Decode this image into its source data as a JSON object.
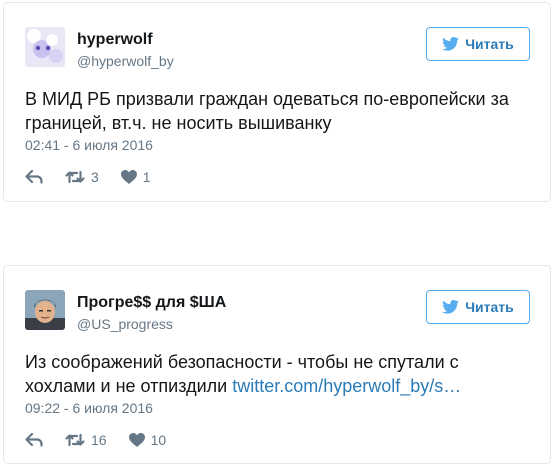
{
  "tweets": [
    {
      "name": "hyperwolf",
      "handle": "@hyperwolf_by",
      "follow_label": "Читать",
      "text": "В МИД РБ призвали граждан одеваться по-европейски за границей, вт.ч. не носить вышиванку",
      "link": "",
      "time": "02:41 - 6 июля 2016",
      "retweets": "3",
      "likes": "1"
    },
    {
      "name": "Прогре$$ для $ША",
      "handle": "@US_progress",
      "follow_label": "Читать",
      "text": "Из соображений безопасности - чтобы не спутали с хохлами и не отпиздили ",
      "link": "twitter.com/hyperwolf_by/s…",
      "time": "09:22 - 6 июля 2016",
      "retweets": "16",
      "likes": "10"
    }
  ],
  "colors": {
    "link": "#2b7bb9",
    "muted": "#657786",
    "border": "#e1e8ed",
    "twitter_blue": "#55acee"
  },
  "icons": [
    "twitter-bird-icon",
    "reply-icon",
    "retweet-icon",
    "heart-icon"
  ]
}
